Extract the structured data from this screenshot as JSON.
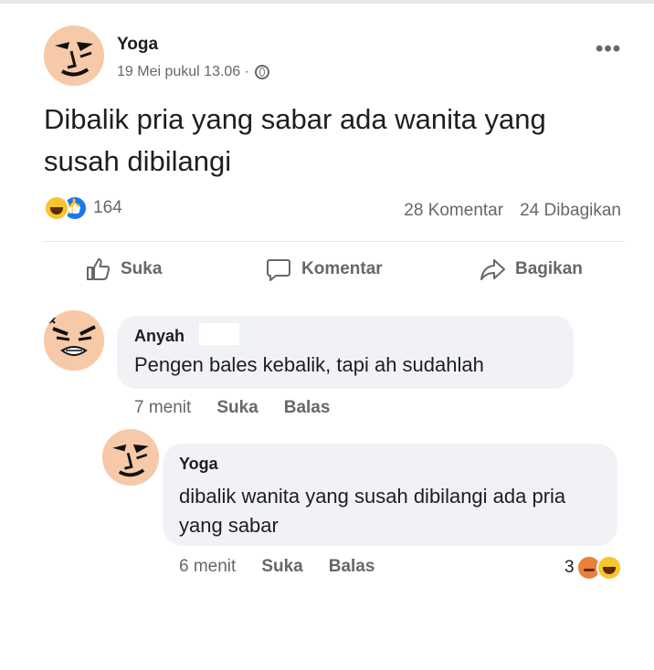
{
  "post": {
    "author": "Yoga",
    "timestamp": "19 Mei pukul 13.06 ·",
    "privacy_icon": "globe-icon",
    "more_label": "•••",
    "text": "Dibalik pria yang sabar ada wanita yang susah dibilangi",
    "reactions": {
      "icons": [
        "haha-icon",
        "like-icon"
      ],
      "count": "164"
    },
    "comments_count": "28 Komentar",
    "shares_count": "24 Dibagikan",
    "actions": {
      "like": "Suka",
      "comment": "Komentar",
      "share": "Bagikan"
    }
  },
  "comments": [
    {
      "author": "Anyah",
      "text": "Pengen bales kebalik, tapi ah sudahlah",
      "time": "7 menit",
      "like": "Suka",
      "reply": "Balas"
    },
    {
      "author": "Yoga",
      "text": "dibalik wanita yang susah dibilangi ada pria yang sabar",
      "time": "6 menit",
      "like": "Suka",
      "reply": "Balas",
      "reaction_count": "3",
      "reaction_icons": [
        "angry-icon",
        "haha-icon"
      ]
    }
  ],
  "colors": {
    "secondary_text": "#65676b",
    "bubble": "#f0f2f5",
    "like_blue": "#1877f2",
    "haha_yellow": "#f7c52c"
  }
}
